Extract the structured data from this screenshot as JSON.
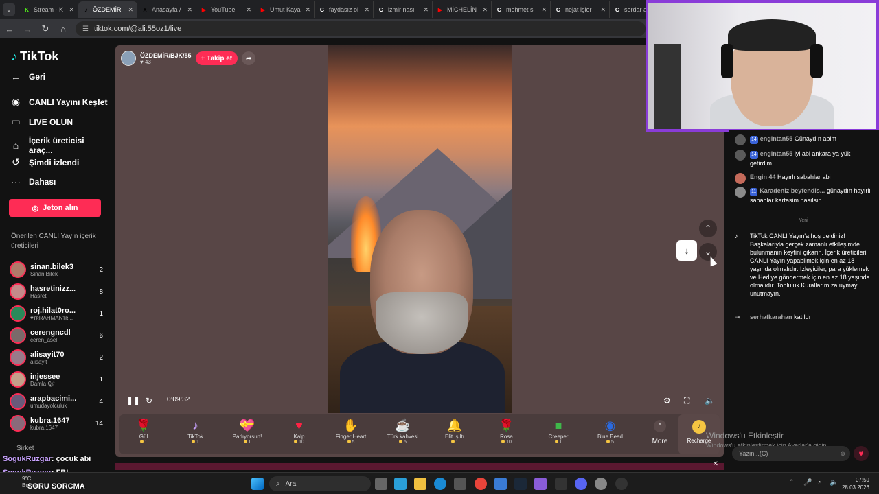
{
  "browser": {
    "tabs": [
      {
        "title": "Stream - K",
        "fav": "K",
        "color": "#53fc18",
        "active": false
      },
      {
        "title": "ÖZDEMİR",
        "fav": "♪",
        "color": "#000000",
        "active": true
      },
      {
        "title": "Anasayfa /",
        "fav": "X",
        "color": "#000000",
        "active": false
      },
      {
        "title": "YouTube",
        "fav": "▶",
        "color": "#ff0000",
        "active": false
      },
      {
        "title": "Umut Kaya",
        "fav": "▶",
        "color": "#ff0000",
        "active": false
      },
      {
        "title": "faydasız ol",
        "fav": "G",
        "color": "#ffffff",
        "active": false
      },
      {
        "title": "izmir nasıl",
        "fav": "G",
        "color": "#ffffff",
        "active": false
      },
      {
        "title": "MİCHELİN",
        "fav": "▶",
        "color": "#ff0000",
        "active": false
      },
      {
        "title": "mehmet s",
        "fav": "G",
        "color": "#ffffff",
        "active": false
      },
      {
        "title": "nejat işler",
        "fav": "G",
        "color": "#ffffff",
        "active": false
      },
      {
        "title": "serdar aka",
        "fav": "G",
        "color": "#ffffff",
        "active": false
      }
    ],
    "url": "tiktok.com/@ali.55oz1/live"
  },
  "sidebar": {
    "logo": "TikTok",
    "nav": [
      {
        "icon": "←",
        "label": "Geri",
        "name": "back"
      },
      {
        "icon": "◉",
        "label": "CANLI Yayını Keşfet",
        "name": "explore-live"
      },
      {
        "icon": "▭",
        "label": "LIVE OLUN",
        "name": "go-live"
      },
      {
        "icon": "⌂",
        "label": "İçerik üreticisi araç...",
        "name": "creator-tools"
      },
      {
        "icon": "↺",
        "label": "Şimdi izlendi",
        "name": "recently-watched"
      },
      {
        "icon": "···",
        "label": "Dahası",
        "name": "more"
      }
    ],
    "jeton_label": "Jeton alın",
    "section_title": "Önerilen CANLI Yayın içerik üreticileri",
    "recommended": [
      {
        "name": "sinan.bilek3",
        "sub": "Sinan Bilek",
        "count": "2"
      },
      {
        "name": "hasretinizz...",
        "sub": "Hasret",
        "count": "8"
      },
      {
        "name": "roj.hilat0ro...",
        "sub": "♥ᴛʀRAHMANᴛʀ...",
        "count": "1"
      },
      {
        "name": "cerengncdl_",
        "sub": "ceren_asel",
        "count": "6"
      },
      {
        "name": "alisayit70",
        "sub": "alisayit",
        "count": "2"
      },
      {
        "name": "injessee",
        "sub": "Damla 🐿",
        "count": "1"
      },
      {
        "name": "arapbacimi...",
        "sub": "umudayolculuk",
        "count": "4"
      },
      {
        "name": "kubra.1647",
        "sub": "kubra.1647",
        "count": "14"
      }
    ],
    "company": "Şirket"
  },
  "stream": {
    "streamer_name": "ÖZDEMİR/BJK/55",
    "likes": "43",
    "follow_label": "+ Takip et",
    "time": "0:09:32"
  },
  "gifts": [
    {
      "icon": "🌹",
      "name": "Gül",
      "price": "1",
      "color": "#e23a5a"
    },
    {
      "icon": "♪",
      "name": "TikTok",
      "price": "1",
      "color": "#c9a3ff"
    },
    {
      "icon": "💝",
      "name": "Parlıyorsun!",
      "price": "1",
      "color": "#ff5a9a"
    },
    {
      "icon": "♥",
      "name": "Kalp",
      "price": "10",
      "color": "#ff2244"
    },
    {
      "icon": "✋",
      "name": "Finger Heart",
      "price": "5",
      "color": "#f0b090"
    },
    {
      "icon": "☕",
      "name": "Türk kahvesi",
      "price": "5",
      "color": "#e8d4b0"
    },
    {
      "icon": "🔔",
      "name": "Elit Işıltı",
      "price": "1",
      "color": "#f5c542"
    },
    {
      "icon": "🌹",
      "name": "Rosa",
      "price": "10",
      "color": "#e23a5a"
    },
    {
      "icon": "■",
      "name": "Creeper",
      "price": "1",
      "color": "#3fb84a"
    },
    {
      "icon": "◉",
      "name": "Blue Bead",
      "price": "5",
      "color": "#2a6ae0"
    }
  ],
  "gift_more_label": "More",
  "recharge_label": "Recharge",
  "chat": {
    "messages": [
      {
        "user": "engintan55",
        "badge": "14",
        "text": "Günaydın abim"
      },
      {
        "user": "engintan55",
        "badge": "14",
        "text": "iyi abi ankara ya yük getirdim"
      },
      {
        "user": "Engin 44",
        "badge": "",
        "text": "Hayırlı sabahlar abi"
      },
      {
        "user": "Karadeniz beyfendis...",
        "badge": "11",
        "text": "günaydın hayırlı sabahlar kartasim nasılsın"
      }
    ],
    "new_label": "Yeni",
    "system_text": "TikTok CANLI Yayın'a hoş geldiniz! Başkalarıyla gerçek zamanlı etkileşimde bulunmanın keyfini çıkarın. İçerik üreticileri CANLI Yayın yapabilmek için en az 18 yaşında olmalıdır. İzleyiciler, para yüklemek ve Hediye göndermek için en az 18 yaşında olmalıdır. Topluluk Kurallarımıza uymayı unutmayın.",
    "joined_user": "serhatkarahan",
    "joined_text": "katıldı",
    "input_placeholder": "Yazın...(C)"
  },
  "windows_watermark": {
    "title": "Windows'u Etkinleştir",
    "sub": "Windows'u etkinleştirmek için Ayarlar'a gidin."
  },
  "overlay_chat": [
    {
      "user": "SogukRuzgar",
      "text": ": çocuk abi"
    },
    {
      "user": "SogukRuzgar",
      "text": ": FBI"
    },
    {
      "user": "",
      "text": "SORU SORCMA"
    }
  ],
  "taskbar": {
    "weather_temp": "9°C",
    "weather_desc": "Bulutlu",
    "search_label": "Ara",
    "time": "07:59",
    "date": "28.03.2026"
  }
}
